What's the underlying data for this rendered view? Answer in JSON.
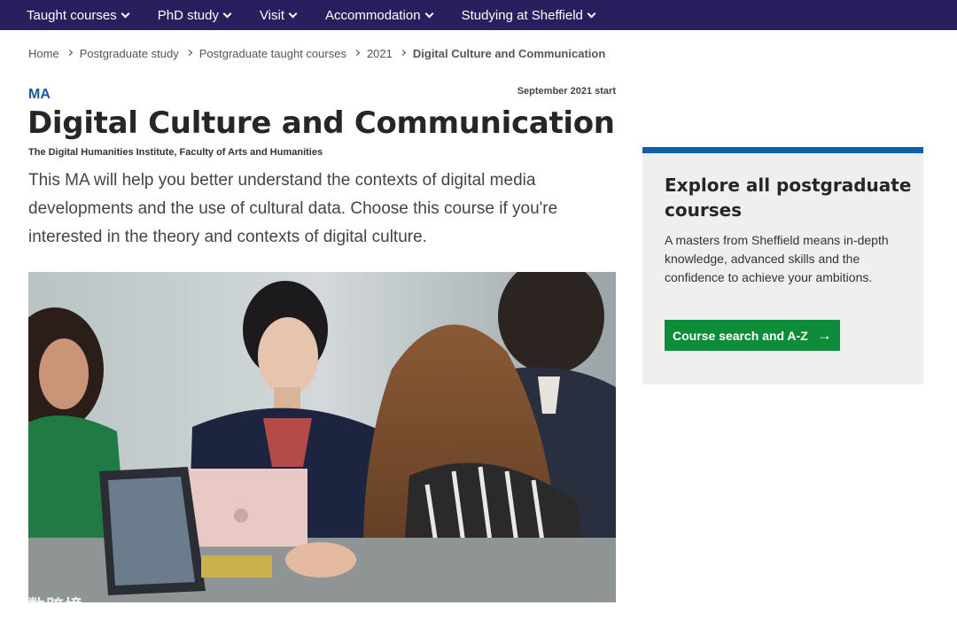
{
  "nav": {
    "items": [
      {
        "label": "Taught courses"
      },
      {
        "label": "PhD study"
      },
      {
        "label": "Visit"
      },
      {
        "label": "Accommodation"
      },
      {
        "label": "Studying at Sheffield"
      }
    ]
  },
  "breadcrumb": {
    "items": [
      "Home",
      "Postgraduate study",
      "Postgraduate taught courses",
      "2021"
    ],
    "current": "Digital Culture and Communication"
  },
  "course": {
    "degree": "MA",
    "start": "September 2021 start",
    "title": "Digital Culture and Communication",
    "department": "The Digital Humanities Institute, Faculty of Arts and Humanities",
    "intro": "This MA will help you better understand the contexts of digital media developments and the use of cultural data. Choose this course if you're interested in the theory and contexts of digital culture."
  },
  "sidebar": {
    "title": "Explore all postgraduate courses",
    "text": "A masters from Sheffield means in-depth knowledge, advanced skills and the confidence to achieve your ambitions.",
    "button_label": "Course search and A-Z"
  },
  "watermark": "大数跨境",
  "colors": {
    "nav_bg": "#2a1f5e",
    "accent_blue": "#0f5fae",
    "button_green": "#0e8c3a"
  }
}
